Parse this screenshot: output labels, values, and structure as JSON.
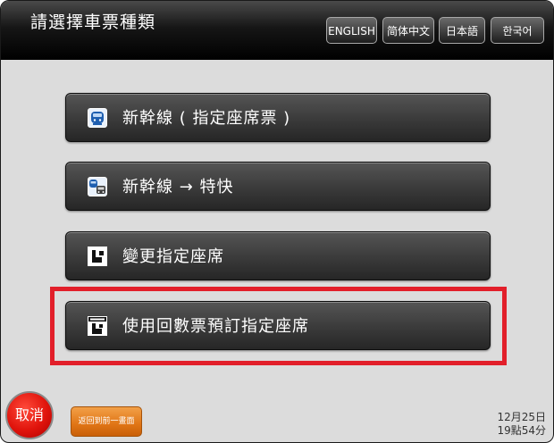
{
  "header": {
    "title": "請選擇車票種類",
    "languages": [
      "ENGLISH",
      "简体中文",
      "日本語",
      "한국어"
    ]
  },
  "menu": {
    "items": [
      {
        "label": "新幹線 ( 指定座席票 )",
        "icon": "shinkansen-train-icon"
      },
      {
        "label": "新幹線 → 特快",
        "icon": "shinkansen-to-express-icon"
      },
      {
        "label": "變更指定座席",
        "icon": "change-seat-icon"
      },
      {
        "label": "使用回數票預訂指定座席",
        "icon": "coupon-ticket-seat-icon"
      }
    ],
    "highlighted_item": "使用回數票預訂指定座席",
    "highlight_color": "#e21f2a"
  },
  "footer": {
    "cancel_label": "取消",
    "back_label": "返回到前一畫面",
    "date": "12月25日",
    "time": "19點54分"
  },
  "colors": {
    "cancel": "#e0140c",
    "back": "#e07515",
    "button": "#3a3a3a"
  }
}
